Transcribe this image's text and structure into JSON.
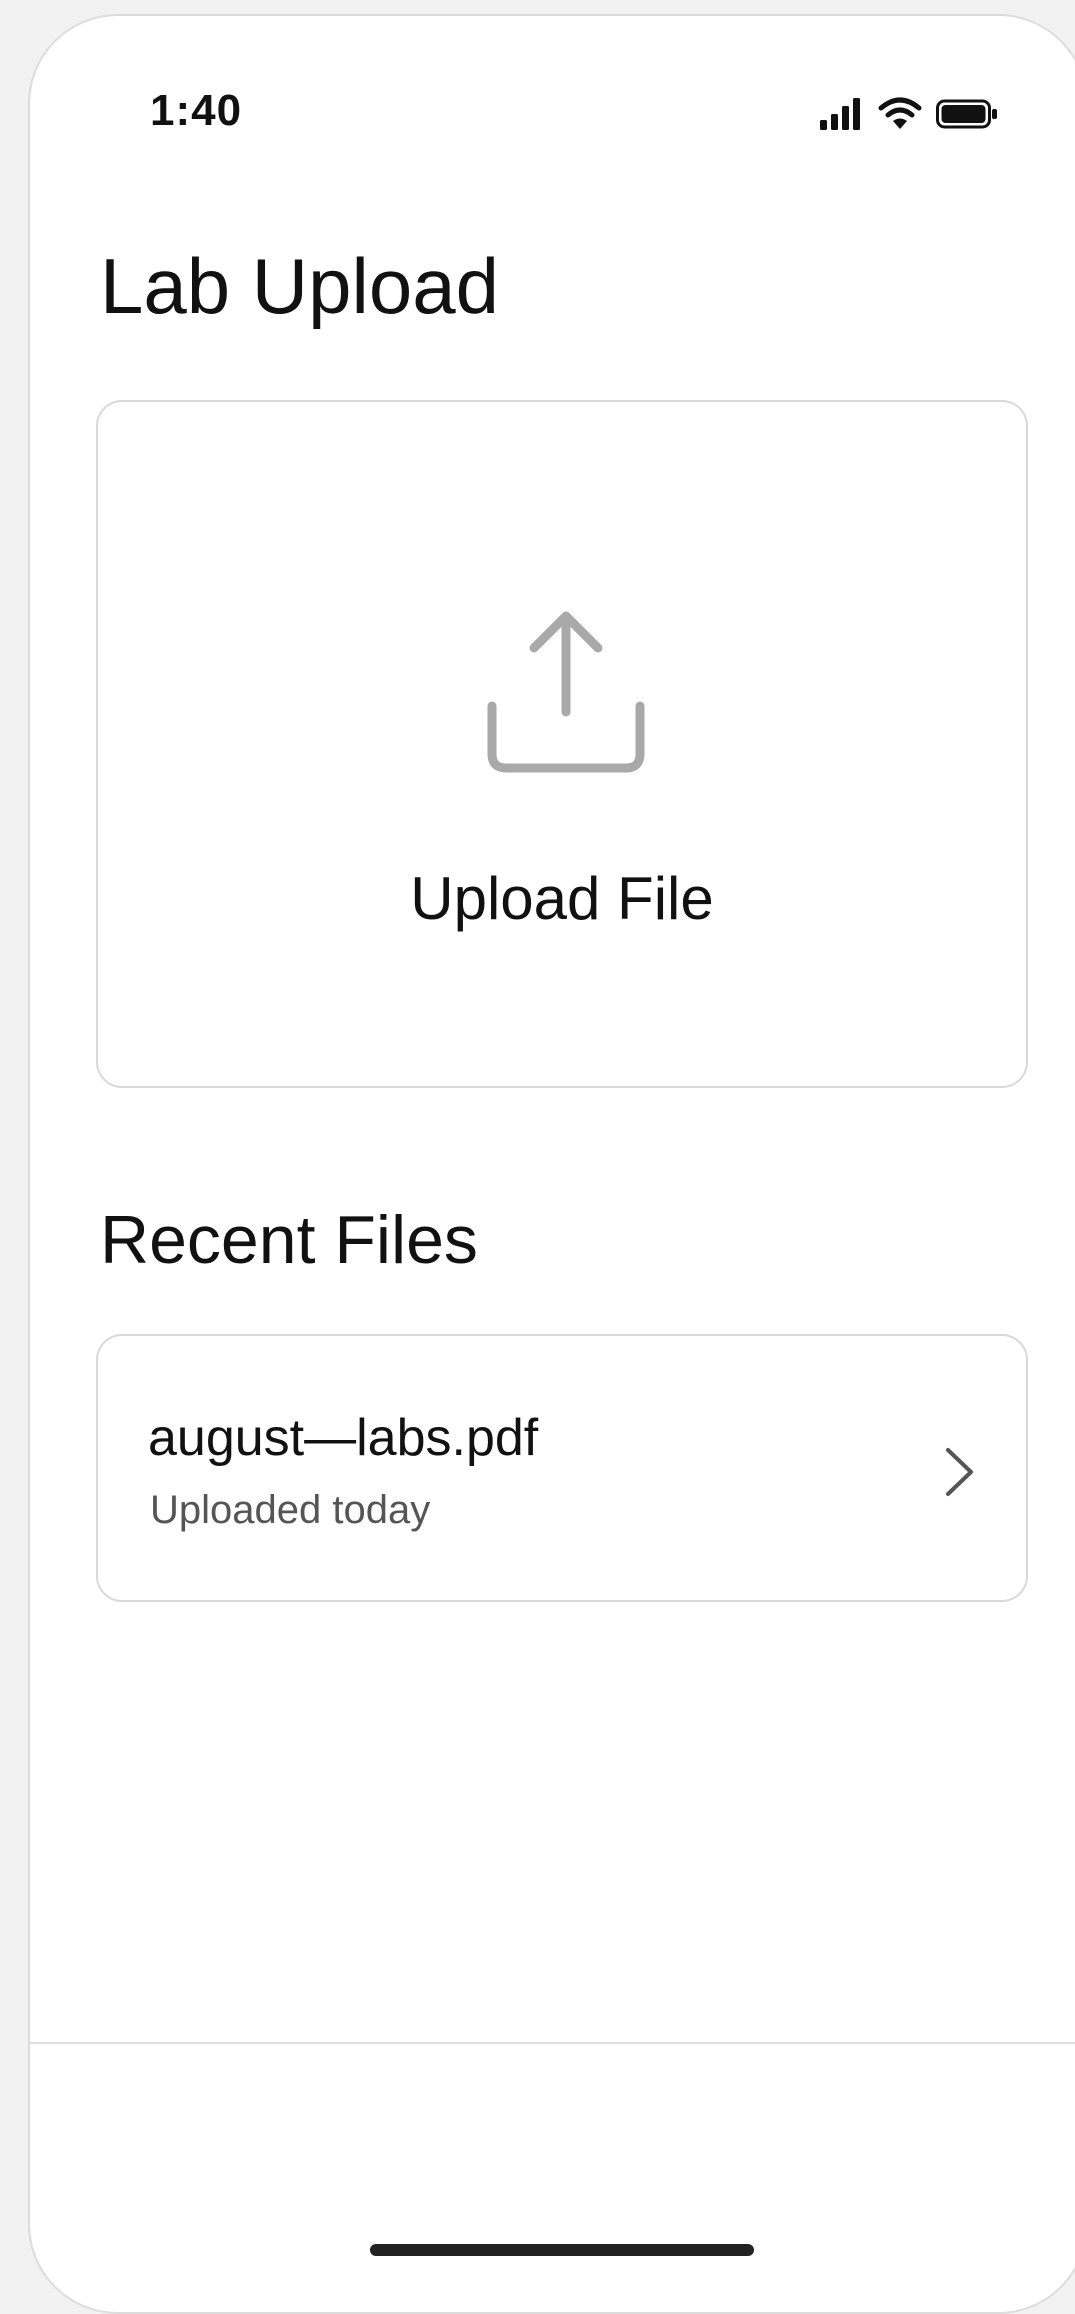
{
  "status_bar": {
    "time": "1:40",
    "icons": [
      "signal-icon",
      "wifi-icon",
      "battery-icon"
    ]
  },
  "header": {
    "title": "Lab Upload"
  },
  "upload": {
    "icon": "upload-icon",
    "label": "Upload File"
  },
  "recent": {
    "title": "Recent Files",
    "files": [
      {
        "name": "august—labs.pdf",
        "meta": "Uploaded today",
        "icon": "chevron-right-icon"
      }
    ]
  },
  "colors": {
    "text": "#111111",
    "secondary_text": "#555555",
    "icon_gray": "#a9a9a9",
    "border": "#d9d9d9",
    "background": "#ffffff"
  }
}
